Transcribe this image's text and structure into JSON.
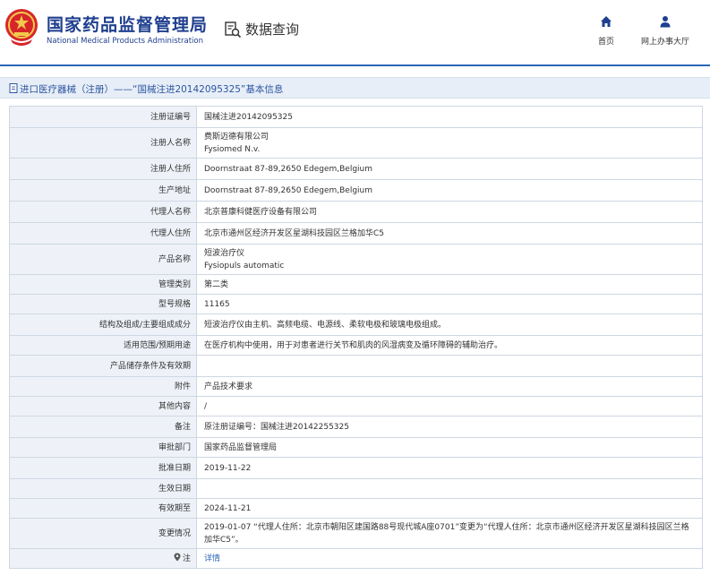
{
  "header": {
    "brand_cn": "国家药品监督管理局",
    "brand_en": "National Medical Products Administration",
    "search_label": "数据查询",
    "nav": [
      {
        "label": "首页",
        "icon": "home-icon"
      },
      {
        "label": "网上办事大厅",
        "icon": "user-icon"
      }
    ]
  },
  "page_title": "进口医疗器械（注册）——“国械注进20142095325”基本信息",
  "colors": {
    "brand": "#1f3f8f",
    "accent": "#2b66b8",
    "label_bg": "#eef2f8",
    "title_bg": "#e8eef7",
    "emblem": "#d7262a",
    "emblem_gold": "#f2c94c"
  },
  "rows": [
    {
      "label": "注册证编号",
      "lines": [
        "国械注进20142095325"
      ]
    },
    {
      "label": "注册人名称",
      "lines": [
        "费斯迈德有限公司",
        "Fysiomed N.v."
      ]
    },
    {
      "label": "注册人住所",
      "lines": [
        "Doornstraat 87-89,2650 Edegem,Belgium"
      ]
    },
    {
      "label": "生产地址",
      "lines": [
        "Doornstraat 87-89,2650 Edegem,Belgium"
      ]
    },
    {
      "label": "代理人名称",
      "lines": [
        "北京普康科健医疗设备有限公司"
      ]
    },
    {
      "label": "代理人住所",
      "lines": [
        "北京市通州区经济开发区星湖科技园区兰格加华C5"
      ]
    },
    {
      "label": "产品名称",
      "lines": [
        "短波治疗仪",
        "Fysiopuls automatic"
      ]
    },
    {
      "label": "管理类别",
      "lines": [
        "第二类"
      ]
    },
    {
      "label": "型号规格",
      "lines": [
        "11165"
      ]
    },
    {
      "label": "结构及组成/主要组成成分",
      "lines": [
        "短波治疗仪由主机、高频电缆、电源线、柔软电极和玻璃电极组成。"
      ]
    },
    {
      "label": "适用范围/预期用途",
      "lines": [
        "在医疗机构中使用，用于对患者进行关节和肌肉的风湿病变及循环障碍的辅助治疗。"
      ]
    },
    {
      "label": "产品储存条件及有效期",
      "lines": [
        ""
      ]
    },
    {
      "label": "附件",
      "lines": [
        "产品技术要求"
      ]
    },
    {
      "label": "其他内容",
      "lines": [
        "/"
      ]
    },
    {
      "label": "备注",
      "lines": [
        "原注册证编号：国械注进20142255325"
      ]
    },
    {
      "label": "审批部门",
      "lines": [
        "国家药品监督管理局"
      ]
    },
    {
      "label": "批准日期",
      "lines": [
        "2019-11-22"
      ]
    },
    {
      "label": "生效日期",
      "lines": [
        ""
      ]
    },
    {
      "label": "有效期至",
      "lines": [
        "2024-11-21"
      ]
    },
    {
      "label": "变更情况",
      "lines": [
        "2019-01-07 “代理人住所：北京市朝阳区建国路88号现代城A座0701”变更为“代理人住所：北京市通州区经济开发区星湖科技园区兰格加华C5”。"
      ]
    },
    {
      "label": "注",
      "lines": [
        "详情"
      ],
      "label_icon": "pin-icon",
      "link": true
    }
  ]
}
